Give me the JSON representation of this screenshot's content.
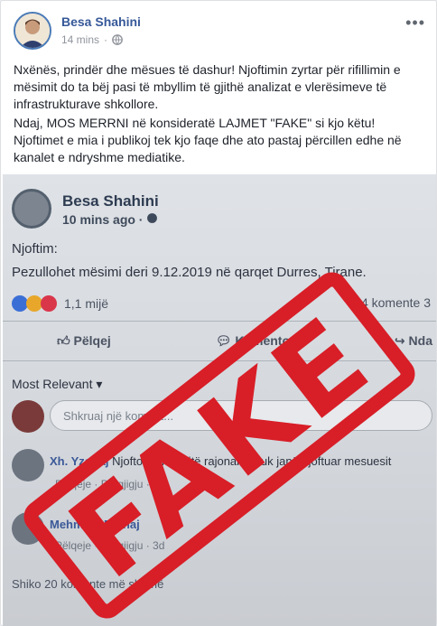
{
  "post": {
    "author": "Besa Shahini",
    "time": "14 mins",
    "privacy_icon": "globe-icon",
    "menu_icon": "more-options-icon",
    "paragraph1": "Nxënës, prindër dhe mësues të dashur! Njoftimin zyrtar për rifillimin e mësimit do ta bëj pasi të mbyllim të gjithë analizat e vlerësimeve të infrastrukturave shkollore.",
    "paragraph2": "Ndaj, MOS MERRNI në konsideratë LAJMET \"FAKE\" si kjo këtu! Njoftimet e mia i publikoj tek kjo faqe dhe ato pastaj përcillen edhe në kanalet e ndryshme mediatike."
  },
  "screenshot": {
    "author": "Besa Shahini",
    "time": "10 mins ago ·",
    "label": "Njoftim:",
    "notice": "Pezullohet mësimi deri 9.12.2019 në qarqet Durres, Tirane.",
    "reactions": "1,1 mijë",
    "comments": "34 komente  3",
    "actions": [
      "Pëlqej",
      "Komento",
      "Nda"
    ],
    "most_relevant": "Most Relevant ▾",
    "comment_placeholder": "Shkruaj një koment...",
    "comment1_author": "Xh. Yzeiraj",
    "comment1_text": "Njoftoni drejtoritë rajonale! Nuk janë njoftuar mesuesit",
    "comment1_meta": "Pëlqeje · Përgjigju · 3d",
    "comment2_author": "Mehmedi Prenaj",
    "comment2_meta": "Pëlqeje · Përgjigju · 3d",
    "view_more": "Shiko 20 komente më shumë",
    "stamp_text": "FAKE",
    "stamp_color": "#d81e27"
  }
}
